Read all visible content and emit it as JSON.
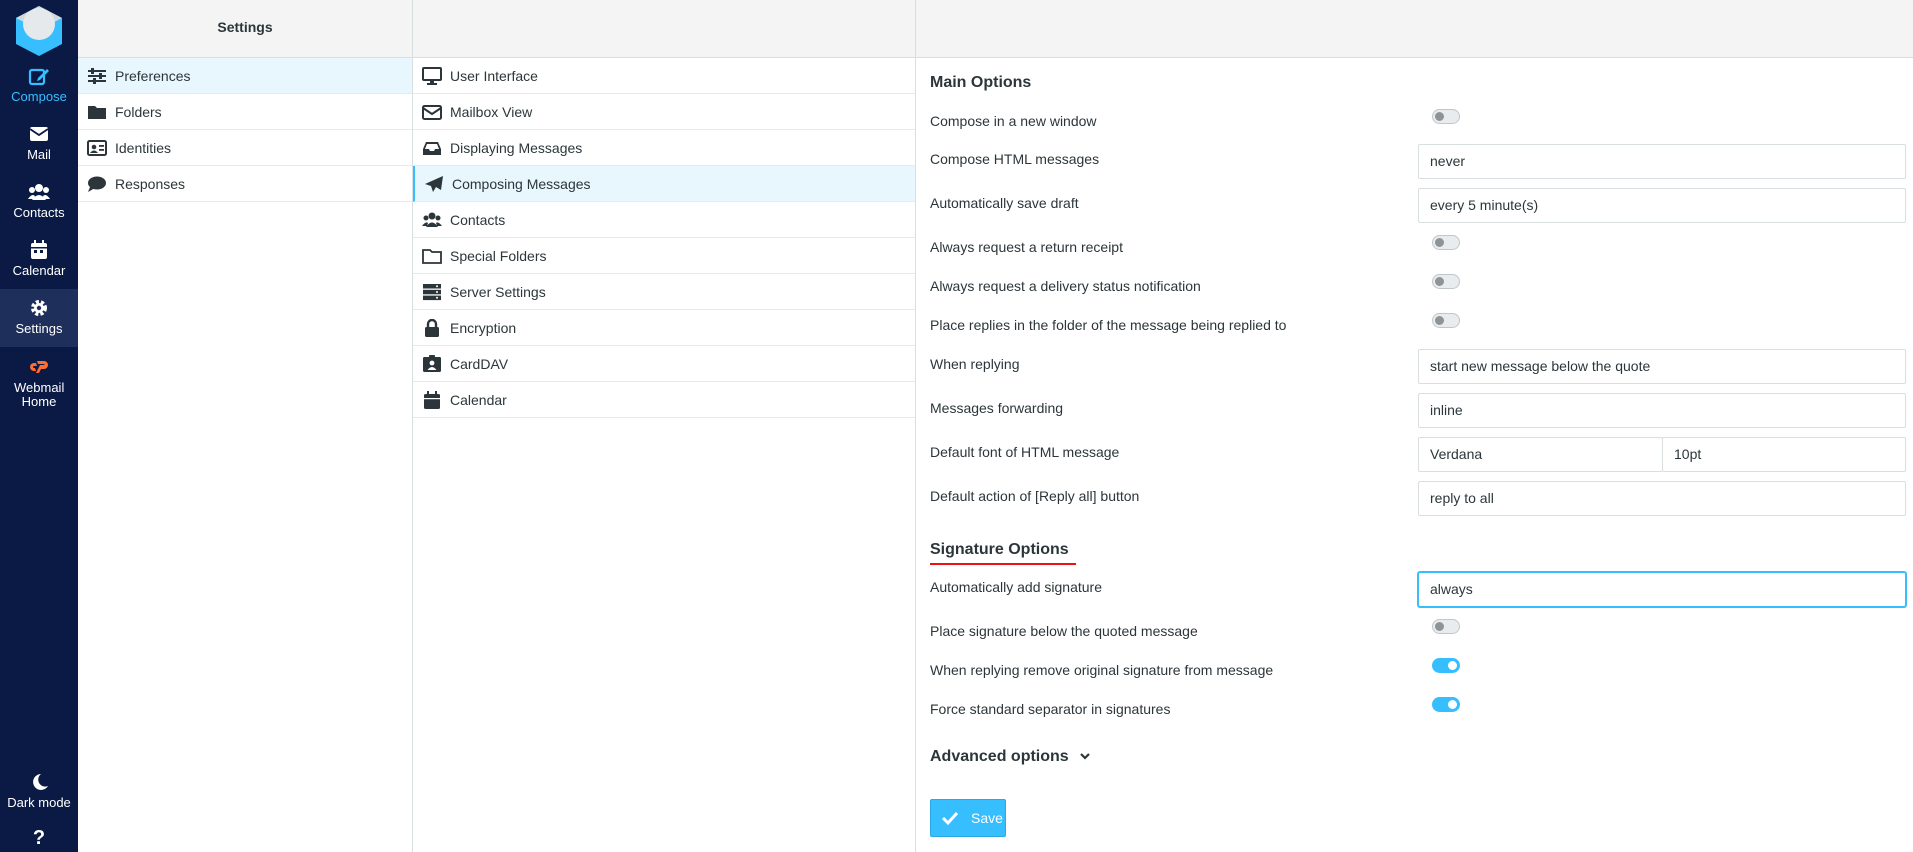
{
  "nav": {
    "compose": "Compose",
    "mail": "Mail",
    "contacts": "Contacts",
    "calendar": "Calendar",
    "settings": "Settings",
    "webmail_home": "Webmail Home",
    "dark_mode": "Dark mode",
    "help": "?"
  },
  "settings_column": {
    "title": "Settings",
    "items": [
      {
        "label": "Preferences",
        "icon": "sliders-icon"
      },
      {
        "label": "Folders",
        "icon": "folder-icon"
      },
      {
        "label": "Identities",
        "icon": "id-card-icon"
      },
      {
        "label": "Responses",
        "icon": "comment-icon"
      }
    ]
  },
  "sections_column": {
    "items": [
      {
        "label": "User Interface",
        "icon": "monitor-icon"
      },
      {
        "label": "Mailbox View",
        "icon": "envelope-icon"
      },
      {
        "label": "Displaying Messages",
        "icon": "inbox-icon"
      },
      {
        "label": "Composing Messages",
        "icon": "paper-plane-icon"
      },
      {
        "label": "Contacts",
        "icon": "users-icon"
      },
      {
        "label": "Special Folders",
        "icon": "folder-open-icon"
      },
      {
        "label": "Server Settings",
        "icon": "server-icon"
      },
      {
        "label": "Encryption",
        "icon": "lock-icon"
      },
      {
        "label": "CardDAV",
        "icon": "address-card-icon"
      },
      {
        "label": "Calendar",
        "icon": "calendar-icon"
      }
    ]
  },
  "form": {
    "main_title": "Main Options",
    "compose_new_window": {
      "label": "Compose in a new window",
      "on": false
    },
    "compose_html": {
      "label": "Compose HTML messages",
      "value": "never"
    },
    "autosave": {
      "label": "Automatically save draft",
      "value": "every 5 minute(s)"
    },
    "return_receipt": {
      "label": "Always request a return receipt",
      "on": false
    },
    "dsn": {
      "label": "Always request a delivery status notification",
      "on": false
    },
    "reply_same_folder": {
      "label": "Place replies in the folder of the message being replied to",
      "on": false
    },
    "reply_mode": {
      "label": "When replying",
      "value": "start new message below the quote"
    },
    "forward_mode": {
      "label": "Messages forwarding",
      "value": "inline"
    },
    "default_font": {
      "label": "Default font of HTML message",
      "font": "Verdana",
      "size": "10pt"
    },
    "reply_all": {
      "label": "Default action of [Reply all] button",
      "value": "reply to all"
    },
    "sig_title": "Signature Options",
    "auto_sig": {
      "label": "Automatically add signature",
      "value": "always"
    },
    "sig_below": {
      "label": "Place signature below the quoted message",
      "on": false
    },
    "strip_sig": {
      "label": "When replying remove original signature from message",
      "on": true
    },
    "sig_separator": {
      "label": "Force standard separator in signatures",
      "on": true
    },
    "advanced": "Advanced options",
    "save": "Save"
  },
  "colors": {
    "accent": "#37beff",
    "rail": "#0a1a45",
    "underline": "#ee1111"
  }
}
